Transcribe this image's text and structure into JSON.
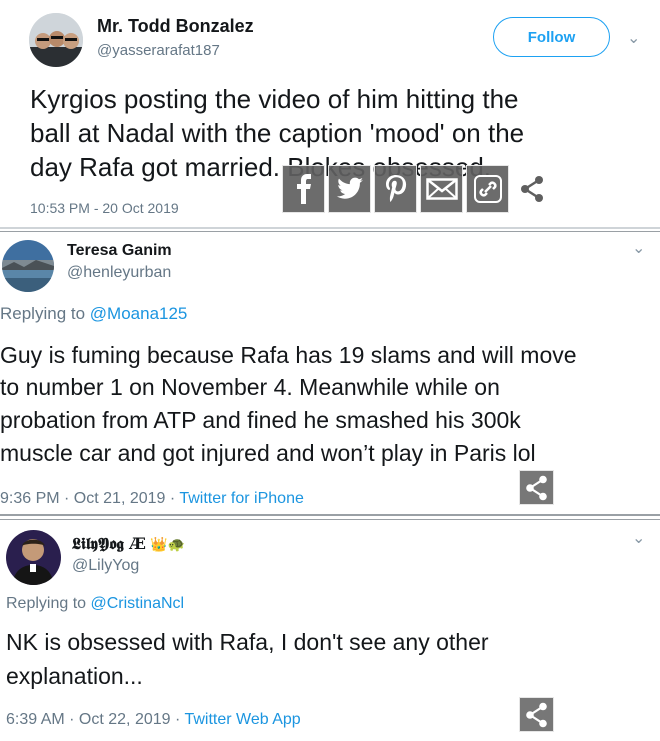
{
  "tweets": [
    {
      "name": "Mr. Todd Bonzalez",
      "handle": "@yasserarafat187",
      "follow_label": "Follow",
      "lines": [
        "Kyrgios posting the video of him hitting the",
        "ball at Nadal with the caption 'mood' on the",
        "day Rafa got married. Blokes obsessed."
      ],
      "timestamp": "10:53 PM - 20 Oct 2019",
      "share_icons": [
        "facebook-icon",
        "twitter-icon",
        "pinterest-icon",
        "email-icon",
        "link-icon",
        "share-icon"
      ]
    },
    {
      "name": "Teresa Ganim",
      "handle": "@henleyurban",
      "reply_prefix": "Replying to ",
      "reply_to": "@Moana125",
      "lines": [
        "Guy is fuming because Rafa has 19 slams and will move",
        "to number 1 on November 4. Meanwhile while on",
        "probation from ATP and fined he smashed his 300k",
        "muscle car and got injured and won’t play in Paris lol"
      ],
      "meta_time": "9:36 PM · Oct 21, 2019 · ",
      "meta_source": "Twitter for iPhone"
    },
    {
      "name": "𝕷𝖎𝖑𝖞𝖄𝖔𝖌 Æ",
      "name_emoji": "👑🐢",
      "handle": "@LilyYog",
      "reply_prefix": "Replying to ",
      "reply_to": "@CristinaNcl",
      "lines": [
        "NK is obsessed with Rafa, I don't see any other",
        "explanation..."
      ],
      "meta_time": "6:39 AM · Oct 22, 2019 · ",
      "meta_source": "Twitter Web App"
    }
  ],
  "colors": {
    "link_blue": "#1b95e0",
    "follow_blue": "#1da1f2",
    "secondary_text": "#657786",
    "share_grey": "#5f5f5f"
  }
}
